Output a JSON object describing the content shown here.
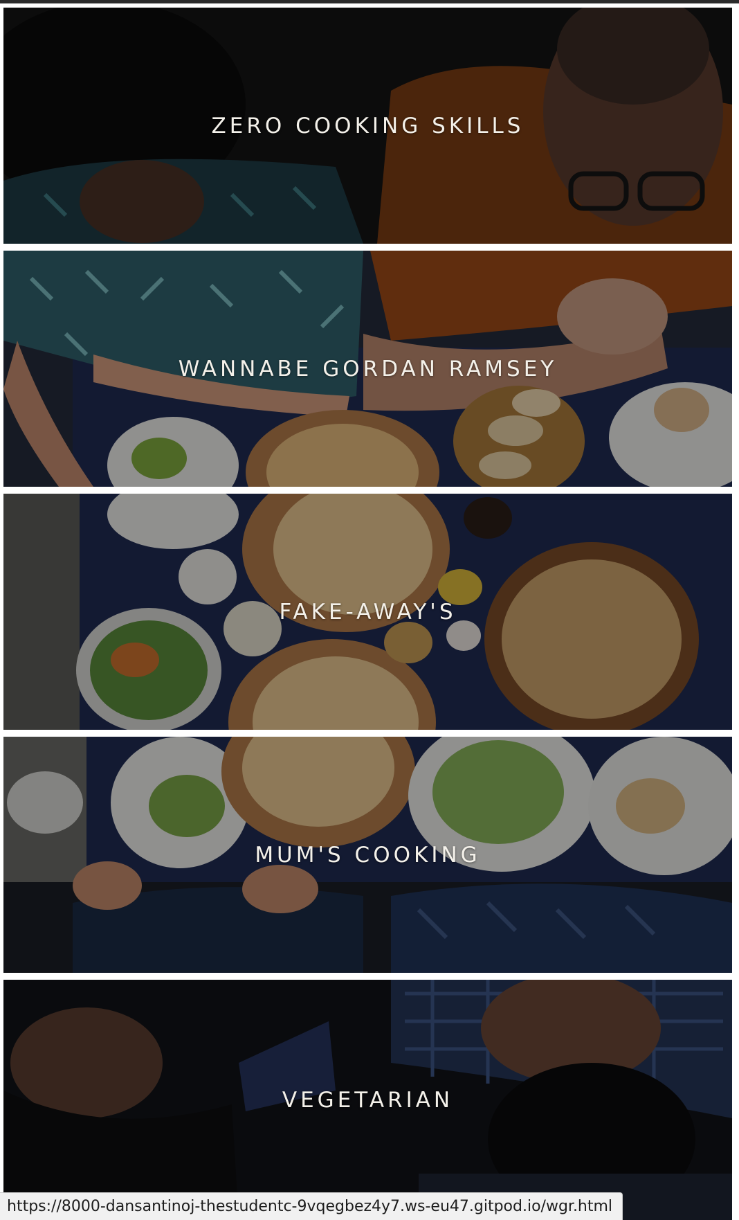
{
  "categories": [
    {
      "label": "ZERO COOKING SKILLS"
    },
    {
      "label": "WANNABE GORDAN RAMSEY"
    },
    {
      "label": "FAKE-AWAY'S"
    },
    {
      "label": "MUM'S COOKING"
    },
    {
      "label": "VEGETARIAN"
    }
  ],
  "status_bar": {
    "url": "https://8000-dansantinoj-thestudentc-9vqegbez4y7.ws-eu47.gitpod.io/wgr.html"
  },
  "colors": {
    "label_text": "#f4f1ea",
    "table_cloth": "#1f2a52",
    "shirt_orange": "#b3541e",
    "overlay": "rgba(0,0,0,0.38)"
  }
}
